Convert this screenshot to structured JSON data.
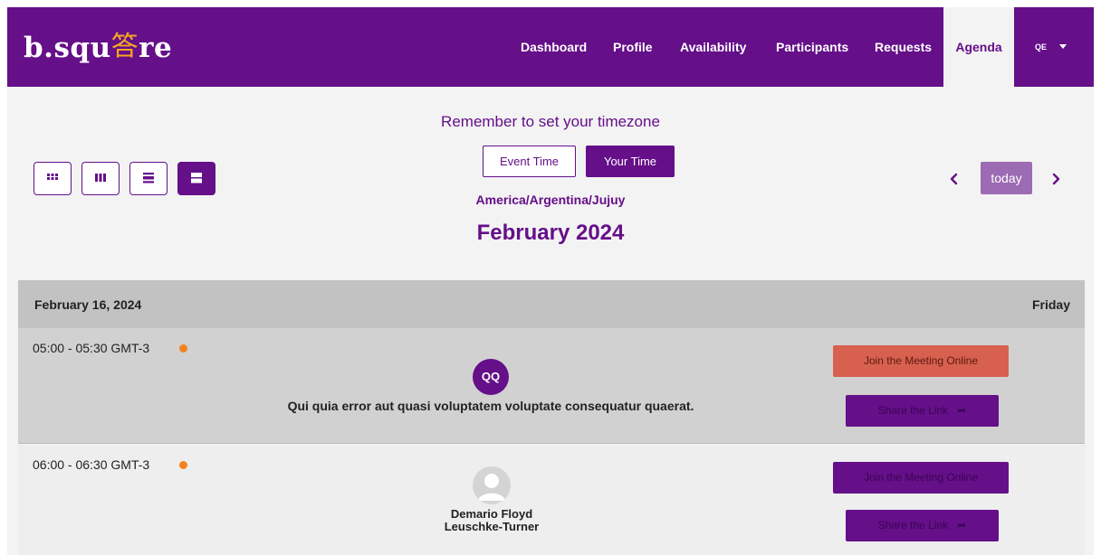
{
  "brand": {
    "logo_prefix": "b.squ",
    "logo_mark": "答",
    "logo_suffix": "re"
  },
  "nav": {
    "items": [
      {
        "label": "Dashboard"
      },
      {
        "label": "Profile"
      },
      {
        "label": "Availability"
      },
      {
        "label": "Participants"
      },
      {
        "label": "Requests"
      },
      {
        "label": "Agenda",
        "active": true
      }
    ],
    "user_initials": "QE"
  },
  "header": {
    "timezone_reminder": "Remember to set your timezone",
    "event_time_label": "Event Time",
    "your_time_label": "Your Time",
    "timezone": "America/Argentina/Jujuy",
    "month": "February 2024",
    "today_label": "today"
  },
  "view_buttons": [
    {
      "icon": "month-grid-icon"
    },
    {
      "icon": "week-columns-icon"
    },
    {
      "icon": "day-list-icon"
    },
    {
      "icon": "agenda-list-icon",
      "active": true
    }
  ],
  "agenda": {
    "date": "February 16, 2024",
    "weekday": "Friday",
    "events": [
      {
        "time": "05:00 - 05:30 GMT-3",
        "avatar_initials": "QQ",
        "title": "Qui quia error aut quasi voluptatem voluptate consequatur quaerat.",
        "join_label": "Join the Meeting Online",
        "share_label": "Share the Link"
      },
      {
        "time": "06:00 - 06:30 GMT-3",
        "person_name_line1": "Demario Floyd",
        "person_name_line2": "Leuschke-Turner",
        "join_label": "Join the Meeting Online",
        "share_label": "Share the Link"
      }
    ]
  },
  "colors": {
    "brand_purple": "#650f89",
    "logo_accent": "#f5a623",
    "status_dot": "#f5821f",
    "join_live": "#d8604f",
    "today": "#9c6bb3"
  }
}
